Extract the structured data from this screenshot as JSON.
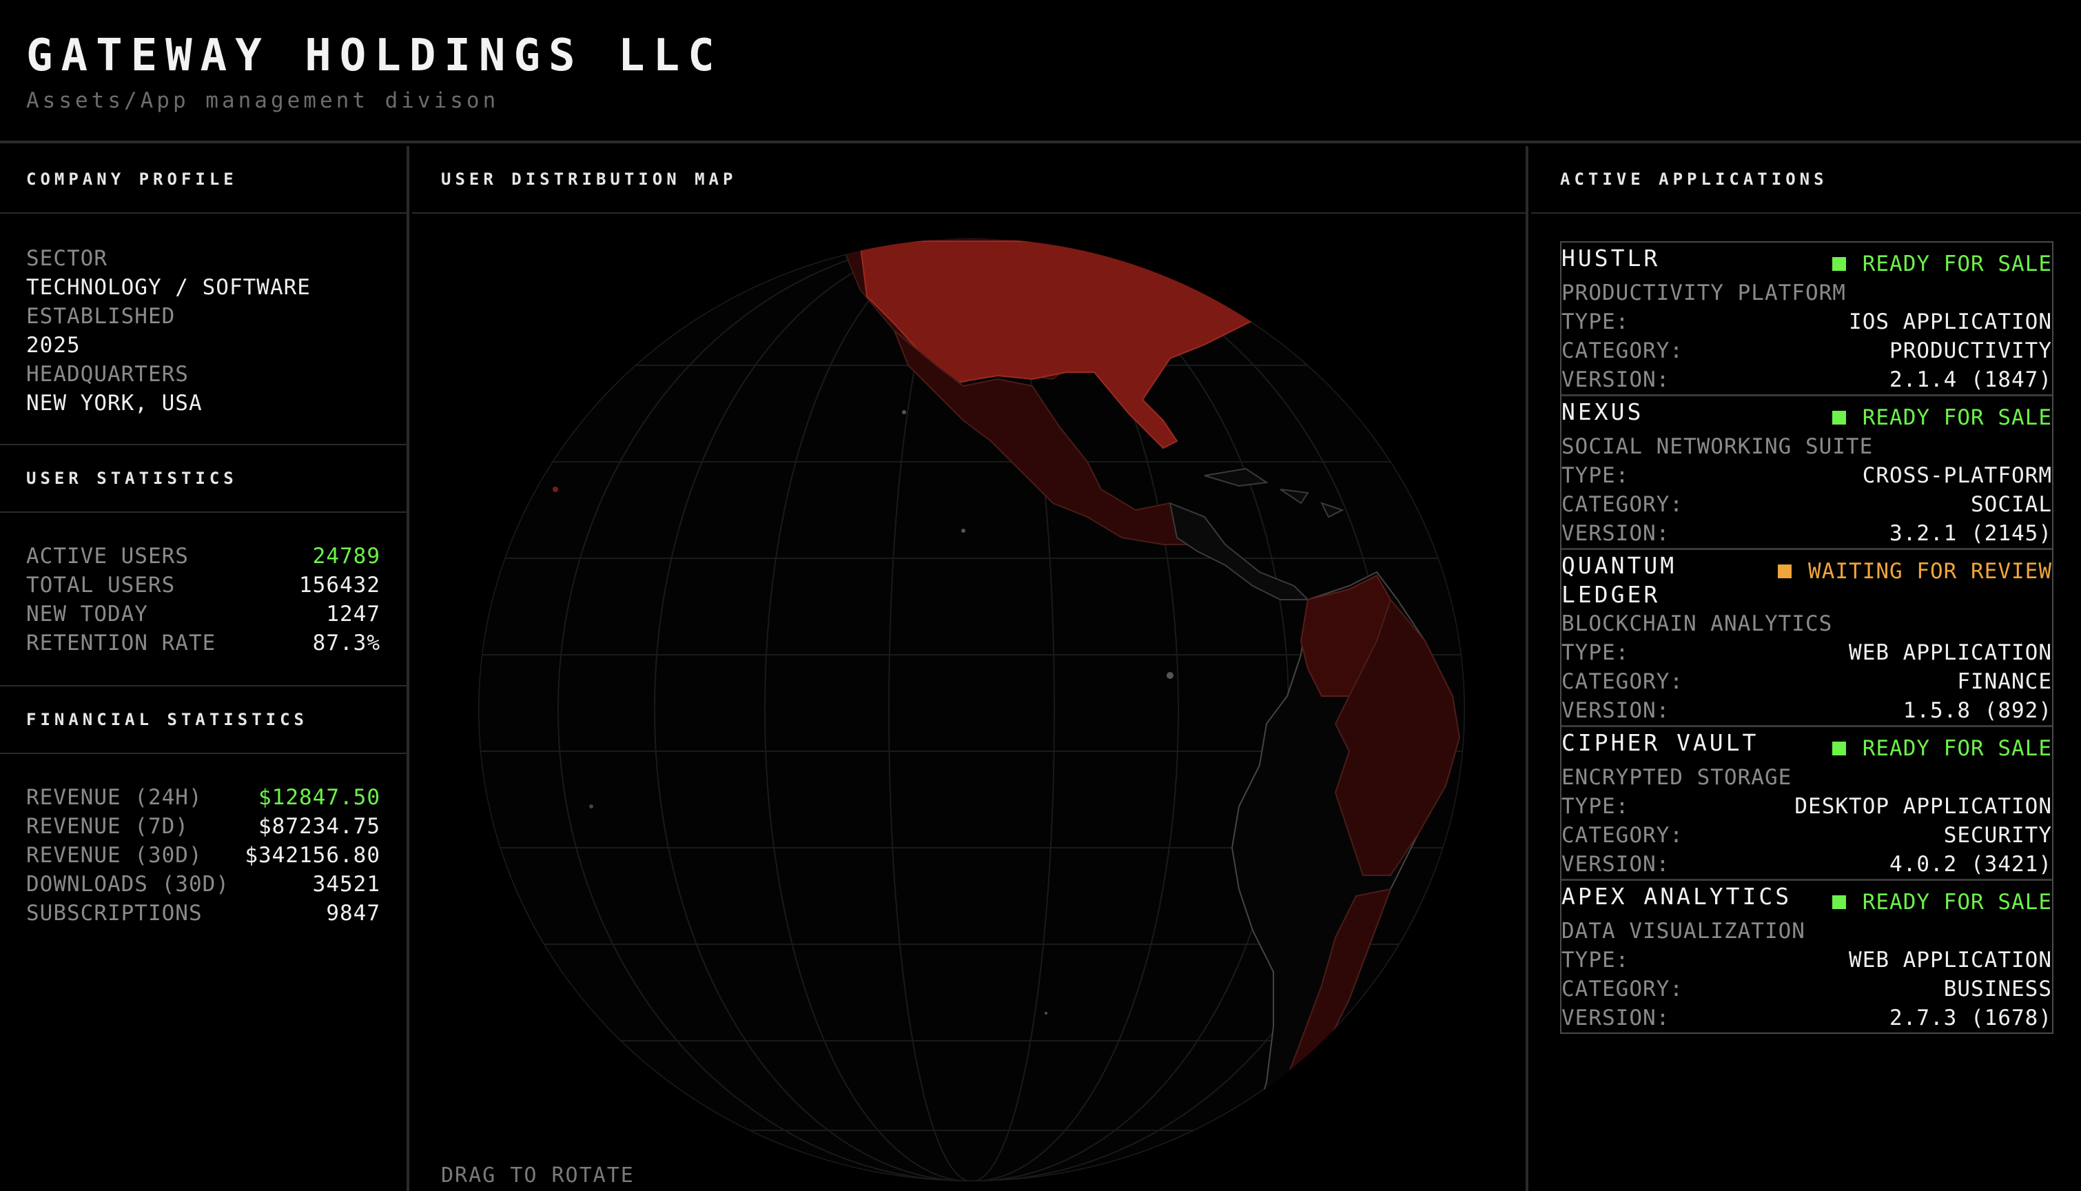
{
  "header": {
    "title": "GATEWAY HOLDINGS LLC",
    "subtitle": "Assets/App management divison"
  },
  "company_profile": {
    "heading": "COMPANY PROFILE",
    "fields": [
      {
        "label": "SECTOR",
        "value": "TECHNOLOGY / SOFTWARE"
      },
      {
        "label": "ESTABLISHED",
        "value": "2025"
      },
      {
        "label": "HEADQUARTERS",
        "value": "NEW YORK, USA"
      }
    ]
  },
  "user_statistics": {
    "heading": "USER STATISTICS",
    "rows": [
      {
        "label": "ACTIVE USERS",
        "value": "24789"
      },
      {
        "label": "TOTAL USERS",
        "value": "156432"
      },
      {
        "label": "NEW TODAY",
        "value": "1247"
      },
      {
        "label": "RETENTION RATE",
        "value": "87.3%"
      }
    ]
  },
  "financial_statistics": {
    "heading": "FINANCIAL STATISTICS",
    "rows": [
      {
        "label": "REVENUE (24H)",
        "value": "$12847.50"
      },
      {
        "label": "REVENUE (7D)",
        "value": "$87234.75"
      },
      {
        "label": "REVENUE (30D)",
        "value": "$342156.80"
      },
      {
        "label": "DOWNLOADS (30D)",
        "value": "34521"
      },
      {
        "label": "SUBSCRIPTIONS",
        "value": "9847"
      }
    ]
  },
  "map": {
    "heading": "USER DISTRIBUTION MAP",
    "hint": "DRAG TO ROTATE"
  },
  "applications": {
    "heading": "ACTIVE APPLICATIONS",
    "field_labels": {
      "type": "TYPE:",
      "category": "CATEGORY:",
      "version": "VERSION:"
    },
    "items": [
      {
        "name": "HUSTLR",
        "status": "READY FOR SALE",
        "description": "PRODUCTIVITY PLATFORM",
        "type": "IOS APPLICATION",
        "category": "PRODUCTIVITY",
        "version": "2.1.4 (1847)"
      },
      {
        "name": "NEXUS",
        "status": "READY FOR SALE",
        "description": "SOCIAL NETWORKING SUITE",
        "type": "CROSS-PLATFORM",
        "category": "SOCIAL",
        "version": "3.2.1 (2145)"
      },
      {
        "name": "QUANTUM LEDGER",
        "status": "WAITING FOR REVIEW",
        "description": "BLOCKCHAIN ANALYTICS",
        "type": "WEB APPLICATION",
        "category": "FINANCE",
        "version": "1.5.8 (892)"
      },
      {
        "name": "CIPHER VAULT",
        "status": "READY FOR SALE",
        "description": "ENCRYPTED STORAGE",
        "type": "DESKTOP APPLICATION",
        "category": "SECURITY",
        "version": "4.0.2 (3421)"
      },
      {
        "name": "APEX ANALYTICS",
        "status": "READY FOR SALE",
        "description": "DATA VISUALIZATION",
        "type": "WEB APPLICATION",
        "category": "BUSINESS",
        "version": "2.7.3 (1678)"
      }
    ]
  },
  "colors": {
    "background": "#000000",
    "accent_green": "#6cf24a",
    "accent_orange": "#f0a53a",
    "map_red": "#7e1a14",
    "map_dark_red": "#2e0806"
  }
}
